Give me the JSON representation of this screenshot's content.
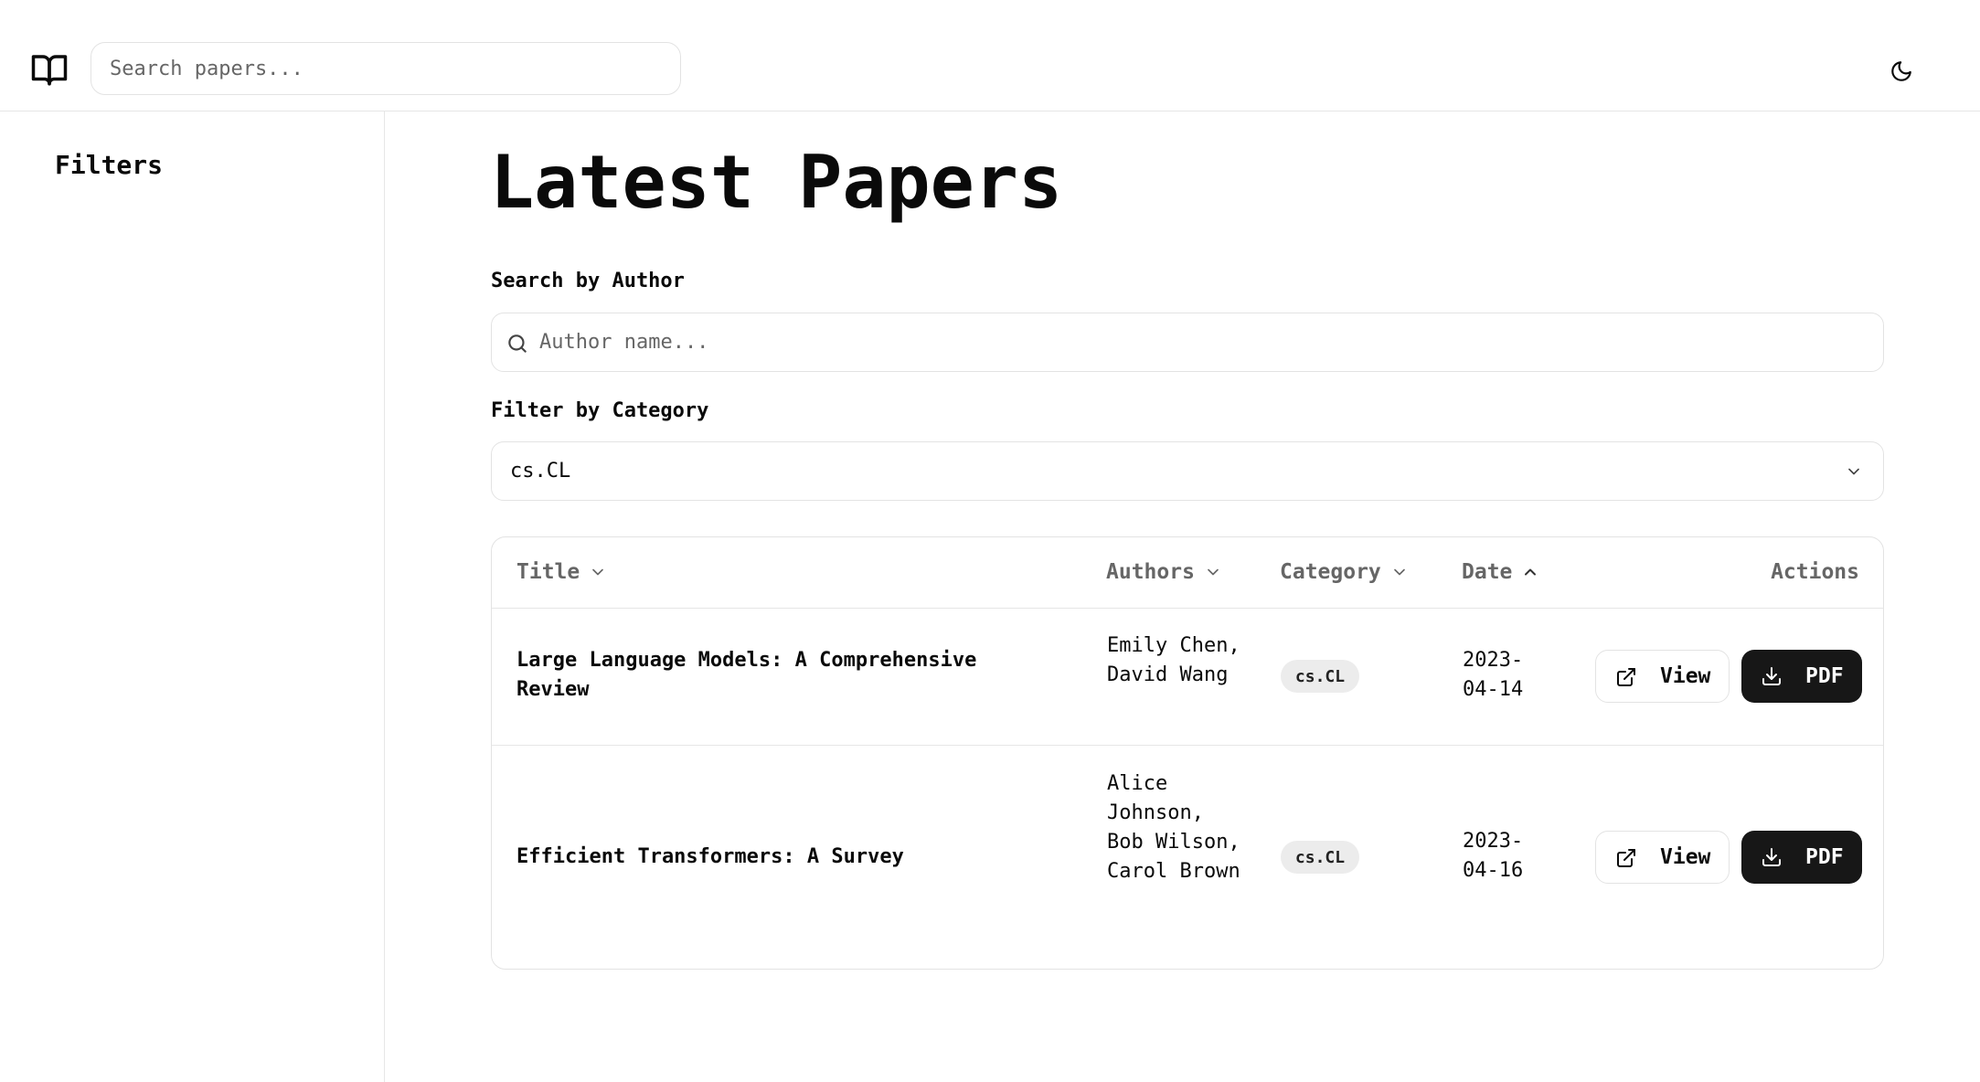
{
  "header": {
    "search_placeholder": "Search papers...",
    "logo_icon": "book-open-icon",
    "theme_icon": "moon-icon"
  },
  "sidebar": {
    "title": "Filters"
  },
  "main": {
    "title": "Latest Papers",
    "author_label": "Search by Author",
    "author_placeholder": "Author name...",
    "category_label": "Filter by Category",
    "category_value": "cs.CL"
  },
  "table": {
    "columns": [
      {
        "label": "Title",
        "sort": "chevron-down-icon"
      },
      {
        "label": "Authors",
        "sort": "chevron-down-icon"
      },
      {
        "label": "Category",
        "sort": "chevron-down-icon"
      },
      {
        "label": "Date",
        "sort": "chevron-up-icon"
      },
      {
        "label": "Actions"
      }
    ],
    "rows": [
      {
        "title": "Large Language Models: A Comprehensive Review",
        "authors": "Emily Chen, David Wang",
        "category": "cs.CL",
        "date": "2023-04-14",
        "view_label": "View",
        "pdf_label": "PDF"
      },
      {
        "title": "Efficient Transformers: A Survey",
        "authors": "Alice Johnson, Bob Wilson, Carol Brown",
        "category": "cs.CL",
        "date": "2023-04-16",
        "view_label": "View",
        "pdf_label": "PDF"
      }
    ]
  },
  "colors": {
    "primary_button": "#171717",
    "border": "#e3e3e3",
    "badge_bg": "#ececec",
    "muted_text": "#666666"
  }
}
